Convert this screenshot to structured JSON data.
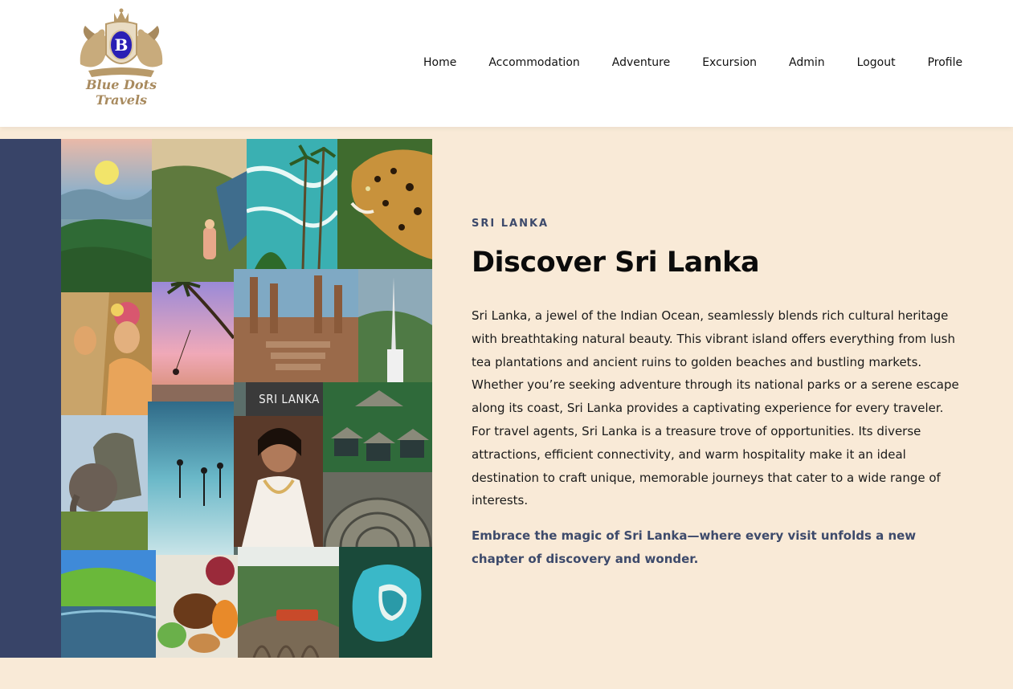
{
  "brand": {
    "logo_line1": "Blue Dots",
    "logo_line2": "Travels",
    "logo_monogram": "B",
    "gold": "#b89a6a",
    "royal_blue": "#2a1fb5"
  },
  "nav": {
    "items": [
      {
        "label": "Home"
      },
      {
        "label": "Accommodation"
      },
      {
        "label": "Adventure"
      },
      {
        "label": "Excursion"
      },
      {
        "label": "Admin"
      },
      {
        "label": "Logout"
      },
      {
        "label": "Profile"
      }
    ]
  },
  "collage": {
    "label": "SRI LANKA",
    "band_color": "#384468"
  },
  "hero": {
    "eyebrow": "SRI LANKA",
    "title": "Discover Sri Lanka",
    "body": "Sri Lanka, a jewel of the Indian Ocean, seamlessly blends rich cultural heritage with breathtaking natural beauty. This vibrant island offers everything from lush tea plantations and ancient ruins to golden beaches and bustling markets. Whether you’re seeking adventure through its national parks or a serene escape along its coast, Sri Lanka provides a captivating experience for every traveler. For travel agents, Sri Lanka is a treasure trove of opportunities. Its diverse attractions, efficient connectivity, and warm hospitality make it an ideal destination to craft unique, memorable journeys that cater to a wide range of interests.",
    "tagline": "Embrace the magic of Sri Lanka—where every visit unfolds a new chapter of discovery and wonder."
  },
  "colors": {
    "background": "#f9ead7",
    "accent": "#3d4a6b"
  }
}
